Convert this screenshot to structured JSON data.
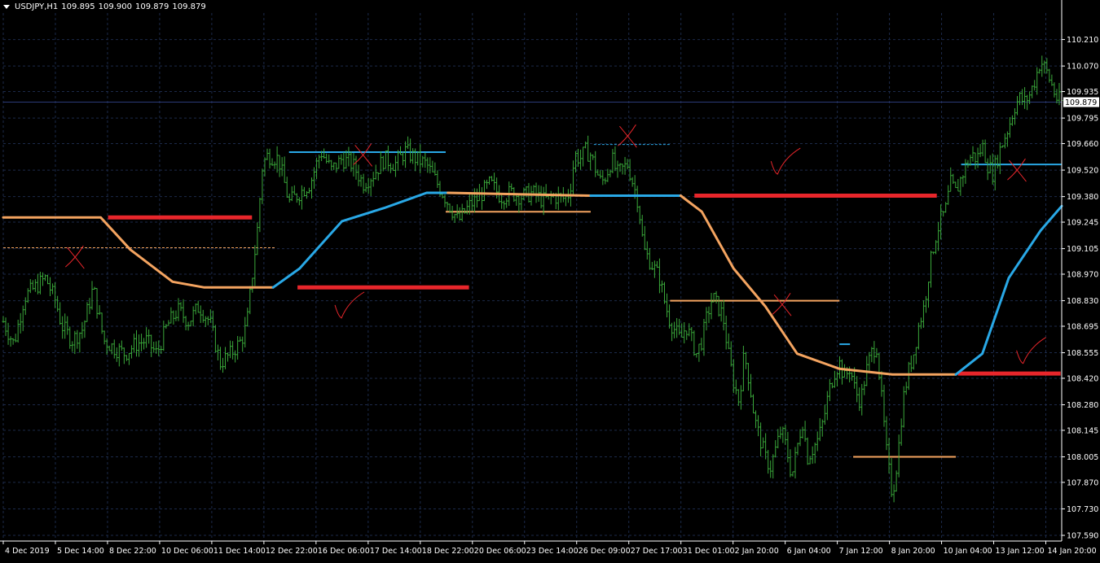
{
  "header": {
    "symbol": "USDJPY,H1",
    "open": "109.895",
    "high": "109.900",
    "low": "109.879",
    "close": "109.879"
  },
  "colors": {
    "background": "#000000",
    "grid": "#1c2a4a",
    "axis": "#ffffff",
    "bars": "#3aa83a",
    "ma_orange": "#f4a460",
    "ma_blue": "#29a8e6",
    "level_red": "#e8262b",
    "level_orange": "#f4a460",
    "level_blue": "#29a8e6",
    "annotation": "#e8262b"
  },
  "chart_data": {
    "type": "ohlc",
    "symbol": "USDJPY",
    "timeframe": "H1",
    "y_ticks": [
      "110.210",
      "110.070",
      "109.935",
      "109.795",
      "109.660",
      "109.520",
      "109.380",
      "109.245",
      "109.105",
      "108.970",
      "108.830",
      "108.695",
      "108.555",
      "108.420",
      "108.280",
      "108.145",
      "108.005",
      "107.870",
      "107.730",
      "107.590"
    ],
    "ylim": [
      107.56,
      110.35
    ],
    "current_price": "109.879",
    "x_labels": [
      "4 Dec 2019",
      "5 Dec 14:00",
      "8 Dec 22:00",
      "10 Dec 06:00",
      "11 Dec 14:00",
      "12 Dec 22:00",
      "16 Dec 06:00",
      "17 Dec 14:00",
      "18 Dec 22:00",
      "20 Dec 06:00",
      "23 Dec 14:00",
      "26 Dec 09:00",
      "27 Dec 17:00",
      "31 Dec 01:00",
      "2 Jan 20:00",
      "6 Jan 04:00",
      "7 Jan 12:00",
      "8 Jan 20:00",
      "10 Jan 04:00",
      "13 Jan 12:00",
      "14 Jan 20:00"
    ],
    "close_path": [
      [
        0,
        108.72
      ],
      [
        0.01,
        108.6
      ],
      [
        0.02,
        108.85
      ],
      [
        0.03,
        108.9
      ],
      [
        0.04,
        108.95
      ],
      [
        0.05,
        108.82
      ],
      [
        0.055,
        108.7
      ],
      [
        0.065,
        108.62
      ],
      [
        0.075,
        108.68
      ],
      [
        0.085,
        108.9
      ],
      [
        0.095,
        108.62
      ],
      [
        0.105,
        108.58
      ],
      [
        0.115,
        108.55
      ],
      [
        0.125,
        108.6
      ],
      [
        0.135,
        108.62
      ],
      [
        0.145,
        108.55
      ],
      [
        0.155,
        108.7
      ],
      [
        0.165,
        108.78
      ],
      [
        0.175,
        108.72
      ],
      [
        0.185,
        108.8
      ],
      [
        0.195,
        108.72
      ],
      [
        0.205,
        108.5
      ],
      [
        0.215,
        108.55
      ],
      [
        0.225,
        108.62
      ],
      [
        0.23,
        108.7
      ],
      [
        0.235,
        108.95
      ],
      [
        0.24,
        109.2
      ],
      [
        0.245,
        109.55
      ],
      [
        0.25,
        109.6
      ],
      [
        0.26,
        109.58
      ],
      [
        0.27,
        109.35
      ],
      [
        0.28,
        109.4
      ],
      [
        0.29,
        109.45
      ],
      [
        0.3,
        109.62
      ],
      [
        0.31,
        109.52
      ],
      [
        0.32,
        109.58
      ],
      [
        0.33,
        109.55
      ],
      [
        0.34,
        109.45
      ],
      [
        0.35,
        109.5
      ],
      [
        0.36,
        109.58
      ],
      [
        0.37,
        109.55
      ],
      [
        0.38,
        109.62
      ],
      [
        0.39,
        109.58
      ],
      [
        0.4,
        109.55
      ],
      [
        0.41,
        109.45
      ],
      [
        0.42,
        109.35
      ],
      [
        0.43,
        109.25
      ],
      [
        0.44,
        109.33
      ],
      [
        0.45,
        109.38
      ],
      [
        0.46,
        109.45
      ],
      [
        0.47,
        109.38
      ],
      [
        0.48,
        109.4
      ],
      [
        0.49,
        109.38
      ],
      [
        0.5,
        109.4
      ],
      [
        0.51,
        109.36
      ],
      [
        0.52,
        109.38
      ],
      [
        0.53,
        109.37
      ],
      [
        0.535,
        109.4
      ],
      [
        0.54,
        109.6
      ],
      [
        0.545,
        109.58
      ],
      [
        0.55,
        109.62
      ],
      [
        0.555,
        109.6
      ],
      [
        0.56,
        109.52
      ],
      [
        0.565,
        109.45
      ],
      [
        0.57,
        109.5
      ],
      [
        0.575,
        109.58
      ],
      [
        0.58,
        109.5
      ],
      [
        0.59,
        109.55
      ],
      [
        0.595,
        109.45
      ],
      [
        0.6,
        109.35
      ],
      [
        0.605,
        109.1
      ],
      [
        0.61,
        109.05
      ],
      [
        0.615,
        109.0
      ],
      [
        0.62,
        108.95
      ],
      [
        0.625,
        108.82
      ],
      [
        0.63,
        108.72
      ],
      [
        0.64,
        108.62
      ],
      [
        0.645,
        108.7
      ],
      [
        0.655,
        108.55
      ],
      [
        0.66,
        108.62
      ],
      [
        0.665,
        108.75
      ],
      [
        0.67,
        108.85
      ],
      [
        0.68,
        108.75
      ],
      [
        0.685,
        108.55
      ],
      [
        0.69,
        108.4
      ],
      [
        0.695,
        108.3
      ],
      [
        0.7,
        108.55
      ],
      [
        0.705,
        108.4
      ],
      [
        0.71,
        108.2
      ],
      [
        0.715,
        108.1
      ],
      [
        0.72,
        108.0
      ],
      [
        0.725,
        107.95
      ],
      [
        0.73,
        108.05
      ],
      [
        0.735,
        108.15
      ],
      [
        0.74,
        108.05
      ],
      [
        0.745,
        107.9
      ],
      [
        0.75,
        108.05
      ],
      [
        0.755,
        108.2
      ],
      [
        0.76,
        108.0
      ],
      [
        0.765,
        108.05
      ],
      [
        0.77,
        108.1
      ],
      [
        0.775,
        108.2
      ],
      [
        0.78,
        108.35
      ],
      [
        0.785,
        108.45
      ],
      [
        0.79,
        108.5
      ],
      [
        0.795,
        108.42
      ],
      [
        0.8,
        108.48
      ],
      [
        0.805,
        108.35
      ],
      [
        0.81,
        108.3
      ],
      [
        0.815,
        108.45
      ],
      [
        0.82,
        108.55
      ],
      [
        0.825,
        108.6
      ],
      [
        0.83,
        108.3
      ],
      [
        0.835,
        108.0
      ],
      [
        0.84,
        107.8
      ],
      [
        0.845,
        108.0
      ],
      [
        0.85,
        108.3
      ],
      [
        0.855,
        108.45
      ],
      [
        0.86,
        108.55
      ],
      [
        0.865,
        108.7
      ],
      [
        0.87,
        108.8
      ],
      [
        0.875,
        109.0
      ],
      [
        0.88,
        109.15
      ],
      [
        0.885,
        109.25
      ],
      [
        0.89,
        109.3
      ],
      [
        0.895,
        109.45
      ],
      [
        0.9,
        109.4
      ],
      [
        0.905,
        109.48
      ],
      [
        0.91,
        109.55
      ],
      [
        0.915,
        109.6
      ],
      [
        0.92,
        109.58
      ],
      [
        0.925,
        109.65
      ],
      [
        0.93,
        109.55
      ],
      [
        0.935,
        109.5
      ],
      [
        0.94,
        109.6
      ],
      [
        0.945,
        109.68
      ],
      [
        0.95,
        109.75
      ],
      [
        0.955,
        109.85
      ],
      [
        0.96,
        109.9
      ],
      [
        0.965,
        109.88
      ],
      [
        0.97,
        109.92
      ],
      [
        0.975,
        110.0
      ],
      [
        0.98,
        110.1
      ],
      [
        0.985,
        110.05
      ],
      [
        0.99,
        109.98
      ],
      [
        0.995,
        109.9
      ],
      [
        1.0,
        109.88
      ]
    ],
    "overlays": [
      {
        "kind": "ma",
        "color": "orange",
        "points": [
          [
            0,
            109.27
          ],
          [
            0.092,
            109.27
          ],
          [
            0.12,
            109.1
          ],
          [
            0.16,
            108.93
          ],
          [
            0.19,
            108.9
          ],
          [
            0.255,
            108.9
          ]
        ]
      },
      {
        "kind": "ma",
        "color": "blue",
        "points": [
          [
            0.255,
            108.9
          ],
          [
            0.28,
            109.0
          ],
          [
            0.32,
            109.25
          ],
          [
            0.36,
            109.32
          ],
          [
            0.4,
            109.4
          ],
          [
            0.42,
            109.4
          ]
        ]
      },
      {
        "kind": "ma",
        "color": "orange",
        "points": [
          [
            0.42,
            109.4
          ],
          [
            0.555,
            109.385
          ]
        ]
      },
      {
        "kind": "ma",
        "color": "blue",
        "points": [
          [
            0.555,
            109.385
          ],
          [
            0.64,
            109.385
          ]
        ]
      },
      {
        "kind": "ma",
        "color": "orange",
        "points": [
          [
            0.64,
            109.385
          ],
          [
            0.66,
            109.3
          ],
          [
            0.69,
            109.0
          ],
          [
            0.72,
            108.8
          ],
          [
            0.75,
            108.55
          ],
          [
            0.79,
            108.47
          ],
          [
            0.84,
            108.44
          ],
          [
            0.9,
            108.44
          ]
        ]
      },
      {
        "kind": "ma",
        "color": "blue",
        "points": [
          [
            0.9,
            108.44
          ],
          [
            0.925,
            108.55
          ],
          [
            0.95,
            108.95
          ],
          [
            0.98,
            109.2
          ],
          [
            1.0,
            109.33
          ]
        ]
      },
      {
        "kind": "level",
        "color": "red",
        "x": [
          0.099,
          0.235
        ],
        "y": 109.27,
        "width": 5
      },
      {
        "kind": "level",
        "color": "red",
        "x": [
          0.278,
          0.44
        ],
        "y": 108.9,
        "width": 5
      },
      {
        "kind": "level",
        "color": "red",
        "x": [
          0.653,
          0.882
        ],
        "y": 109.385,
        "width": 5
      },
      {
        "kind": "level",
        "color": "red",
        "x": [
          0.902,
          0.999
        ],
        "y": 108.445,
        "width": 5
      },
      {
        "kind": "level",
        "color": "orange",
        "x": [
          0.0,
          0.257
        ],
        "y": 109.11,
        "width": 1,
        "dashed": true
      },
      {
        "kind": "level",
        "color": "blue",
        "x": [
          0.27,
          0.418
        ],
        "y": 109.615,
        "width": 2
      },
      {
        "kind": "level",
        "color": "orange",
        "x": [
          0.418,
          0.555
        ],
        "y": 109.3,
        "width": 2
      },
      {
        "kind": "level",
        "color": "blue",
        "x": [
          0.558,
          0.63
        ],
        "y": 109.655,
        "width": 1,
        "dashed": true
      },
      {
        "kind": "level",
        "color": "orange",
        "x": [
          0.63,
          0.79
        ],
        "y": 108.83,
        "width": 2
      },
      {
        "kind": "level",
        "color": "orange",
        "x": [
          0.803,
          0.9
        ],
        "y": 108.005,
        "width": 2
      },
      {
        "kind": "level",
        "color": "blue",
        "x": [
          0.905,
          1.0
        ],
        "y": 109.55,
        "width": 2
      },
      {
        "kind": "level",
        "color": "blue",
        "x": [
          0.79,
          0.8
        ],
        "y": 108.6,
        "width": 2
      }
    ],
    "annotations": [
      {
        "kind": "cross",
        "x": 0.068,
        "y": 109.06
      },
      {
        "kind": "cross",
        "x": 0.34,
        "y": 109.6
      },
      {
        "kind": "cross",
        "x": 0.59,
        "y": 109.7
      },
      {
        "kind": "cross",
        "x": 0.736,
        "y": 108.81
      },
      {
        "kind": "cross",
        "x": 0.958,
        "y": 109.52
      },
      {
        "kind": "check",
        "x": 0.318,
        "y": 108.79
      },
      {
        "kind": "check",
        "x": 0.73,
        "y": 109.55
      },
      {
        "kind": "check",
        "x": 0.962,
        "y": 108.55
      }
    ]
  }
}
